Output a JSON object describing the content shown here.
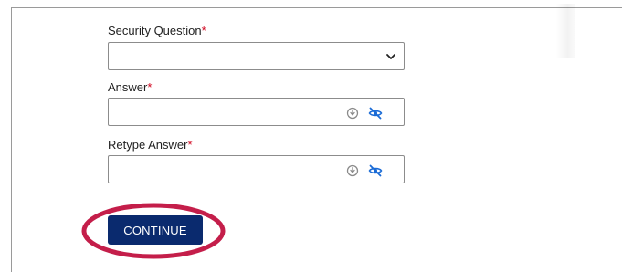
{
  "colors": {
    "required": "#d0021b",
    "primary_button": "#0a2a6e",
    "annotation_ring": "#c41e4a",
    "icon_gray": "#8a8a8a",
    "icon_blue": "#1a6bd6"
  },
  "form": {
    "security_question": {
      "label": "Security Question",
      "required_mark": "*",
      "value": "",
      "icon": "chevron-down-icon"
    },
    "answer": {
      "label": "Answer",
      "required_mark": "*",
      "value": "",
      "icons": [
        "password-manager-icon",
        "hide-password-icon"
      ]
    },
    "retype_answer": {
      "label": "Retype Answer",
      "required_mark": "*",
      "value": "",
      "icons": [
        "password-manager-icon",
        "hide-password-icon"
      ]
    },
    "continue_button": {
      "label": "CONTINUE"
    }
  },
  "annotation": {
    "shape": "ellipse",
    "target": "continue-button"
  }
}
